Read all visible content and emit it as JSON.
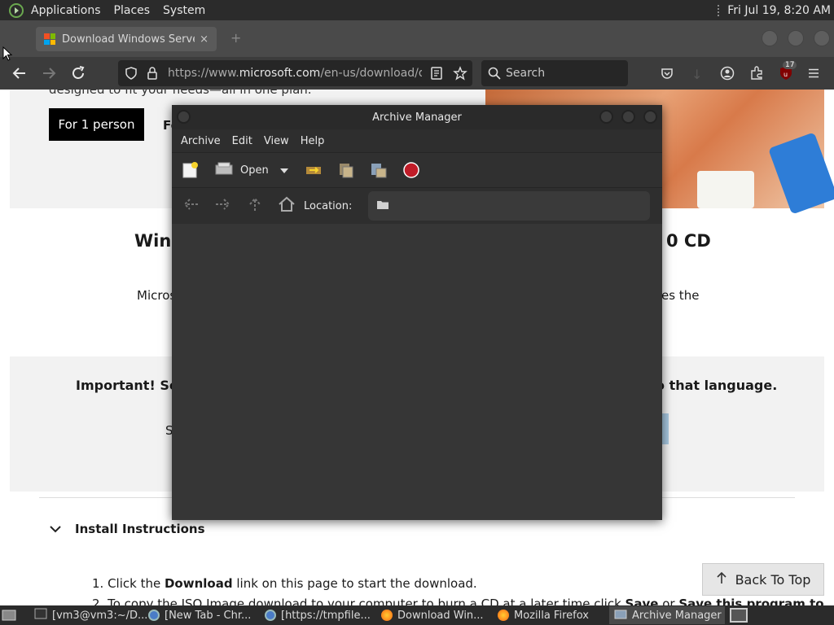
{
  "top_panel": {
    "menus": [
      "Applications",
      "Places",
      "System"
    ],
    "clock": "Fri Jul 19,  8:20 AM"
  },
  "firefox": {
    "tab_title": "Download Windows Server",
    "tab_close": "×",
    "url_prefix": "https://www.",
    "url_domain": "microsoft.com",
    "url_suffix": "/en-us/download/deta",
    "search_placeholder": "Search",
    "ublock_count": "17"
  },
  "webpage": {
    "partial_top_text": "designed to fit your needs—all in one plan.",
    "for_one_person": "For 1 person",
    "fo_text": "Fo",
    "heading_left": "Win",
    "heading_right": "0 CD",
    "para_left": "Micros",
    "para_right": "es the",
    "important_left": "Important! Sele",
    "important_right": "o that language.",
    "s_text": "S",
    "install_instructions": "Install Instructions",
    "step1_pre": "1. Click the ",
    "step1_bold": "Download",
    "step1_post": " link on this page to start the download.",
    "step2_pre": "2. To copy the ISO Image download to your computer to burn a CD at a later time click ",
    "step2_bold1": "Save",
    "step2_mid": " or ",
    "step2_bold2": "Save this program to",
    "back_to_top": "Back To Top"
  },
  "archive_manager": {
    "title": "Archive Manager",
    "menu": [
      "Archive",
      "Edit",
      "View",
      "Help"
    ],
    "open_label": "Open",
    "location_label": "Location:",
    "location_value": ""
  },
  "taskbar": {
    "tasks": [
      {
        "label": "[vm3@vm3:~/D...",
        "icon": "terminal-icon"
      },
      {
        "label": "[New Tab - Chr...",
        "icon": "chrome-icon"
      },
      {
        "label": "[https://tmpfile...",
        "icon": "chrome-icon"
      },
      {
        "label": "Download Win...",
        "icon": "firefox-icon"
      },
      {
        "label": "Mozilla Firefox",
        "icon": "firefox-icon"
      },
      {
        "label": "Archive Manager",
        "icon": "archive-icon"
      }
    ]
  }
}
